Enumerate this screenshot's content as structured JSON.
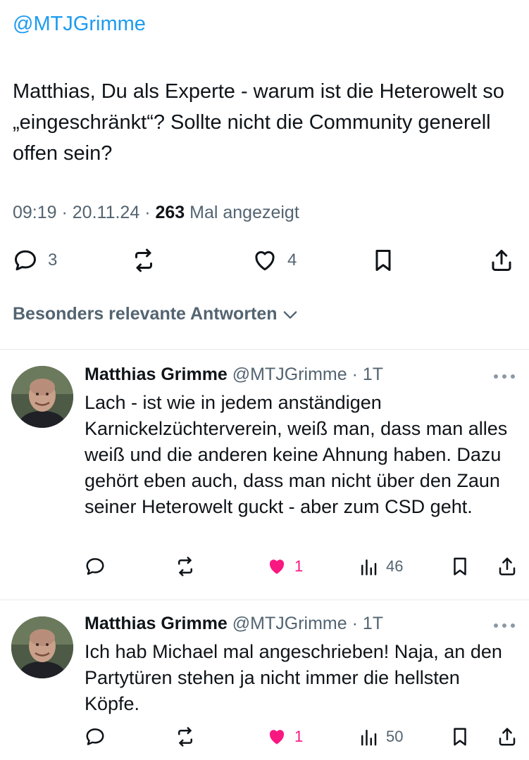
{
  "post": {
    "mention": "@MTJGrimme",
    "text": "Matthias, Du als Experte - warum ist die Heterowelt so „eingeschränkt“? Sollte nicht die Community generell offen sein?",
    "time": "09:19",
    "sep1": " · ",
    "date": "20.11.24",
    "sep2": " · ",
    "views": "263",
    "views_label": " Mal angezeigt",
    "actions": {
      "reply_icon": "reply-icon",
      "replies": "3",
      "retweet_icon": "retweet-icon",
      "like_icon": "heart-icon",
      "likes": "4",
      "bookmark_icon": "bookmark-icon",
      "share_icon": "share-icon"
    }
  },
  "relevance_label": "Besonders relevante Antworten",
  "replies": [
    {
      "name": "Matthias Grimme",
      "handle": " @MTJGrimme",
      "sep": " · ",
      "age": "1T",
      "text": "Lach - ist wie in jedem anständigen Karnickelzüchterverein, weiß man, dass man alles weiß und die anderen keine Ahnung haben. Dazu gehört eben auch, dass man nicht über den Zaun seiner Heterowelt guckt - aber zum CSD geht.",
      "likes": "1",
      "views": "46"
    },
    {
      "name": "Matthias Grimme",
      "handle": " @MTJGrimme",
      "sep": " · ",
      "age": "1T",
      "text": "Ich hab Michael mal angeschrieben! Naja, an den Partytüren stehen ja nicht immer die hellsten Köpfe.",
      "likes": "1",
      "views": "50"
    }
  ],
  "colors": {
    "link": "#1d9bf0",
    "muted": "#536471",
    "like": "#f91880",
    "text": "#0f1419"
  }
}
